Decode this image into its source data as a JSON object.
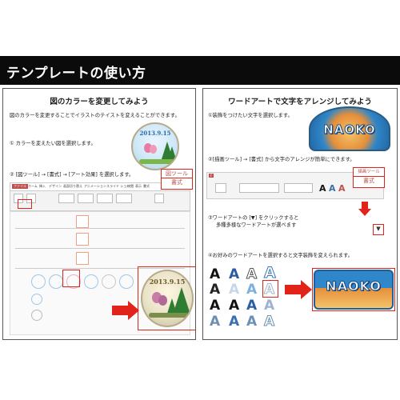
{
  "page_title": "テンプレートの使い方",
  "left": {
    "heading": "図のカラーを変更してみよう",
    "intro": "図のカラーを変更することでイラストのテイストを変えることができます。",
    "step1": "① カラーを変えたい図を選択します。",
    "step2": "② [図ツール] → [書式] → [アート効果] を選択します。",
    "badge_date": "2013.9.15",
    "tag_line1": "図ツール",
    "tag_line2": "書式",
    "ribbon_tabs": [
      "ファイル",
      "ホーム",
      "挿入",
      "デザイン",
      "画面切り替え",
      "アニメーション",
      "スライド ショー",
      "校閲",
      "表示",
      "書式"
    ],
    "window_title": "(ファイル).pptx - PowerPoint"
  },
  "right": {
    "heading": "ワードアートで文字をアレンジしてみよう",
    "step1": "①装飾をつけたい文字を選択します。",
    "step2": "②[描画ツール] → [書式] から文字のアレンジが簡単にできます。",
    "step3_line1": "③ワードアートの [▼] をクリックすると",
    "step3_line2": "多種多様なワードアートが選べます",
    "step4": "④お好みのワードアートを選択すると文字装飾を変えられます。",
    "badge_text": "NAOKO",
    "tag_line1": "描画ツール",
    "tag_line2": "書式",
    "dropdown_glyph": "▼",
    "wordart_letter": "A",
    "window_title": "(ファイル).pptx - PowerPoint"
  },
  "colors": {
    "accent_red": "#e2231a",
    "title_bg": "#0b0b0b"
  }
}
